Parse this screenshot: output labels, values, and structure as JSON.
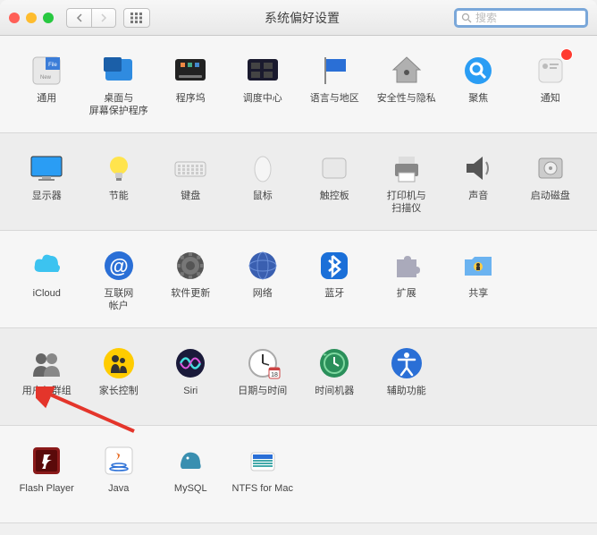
{
  "window": {
    "title": "系统偏好设置",
    "search_placeholder": "搜索"
  },
  "rows": [
    {
      "items": [
        {
          "id": "general",
          "label": "通用",
          "icon": "general"
        },
        {
          "id": "desktop",
          "label": "桌面与\n屏幕保护程序",
          "icon": "desktop"
        },
        {
          "id": "dock",
          "label": "程序坞",
          "icon": "dock"
        },
        {
          "id": "mission",
          "label": "调度中心",
          "icon": "mission"
        },
        {
          "id": "language",
          "label": "语言与地区",
          "icon": "flag"
        },
        {
          "id": "security",
          "label": "安全性与隐私",
          "icon": "house"
        },
        {
          "id": "spotlight",
          "label": "聚焦",
          "icon": "search"
        },
        {
          "id": "notifications",
          "label": "通知",
          "icon": "notif",
          "badge": true
        }
      ]
    },
    {
      "items": [
        {
          "id": "displays",
          "label": "显示器",
          "icon": "display"
        },
        {
          "id": "energy",
          "label": "节能",
          "icon": "bulb"
        },
        {
          "id": "keyboard",
          "label": "键盘",
          "icon": "keyboard"
        },
        {
          "id": "mouse",
          "label": "鼠标",
          "icon": "mouse"
        },
        {
          "id": "trackpad",
          "label": "触控板",
          "icon": "trackpad"
        },
        {
          "id": "printers",
          "label": "打印机与\n扫描仪",
          "icon": "printer"
        },
        {
          "id": "sound",
          "label": "声音",
          "icon": "speaker"
        },
        {
          "id": "startup",
          "label": "启动磁盘",
          "icon": "disk"
        }
      ]
    },
    {
      "items": [
        {
          "id": "icloud",
          "label": "iCloud",
          "icon": "cloud"
        },
        {
          "id": "internet",
          "label": "互联网\n帐户",
          "icon": "at"
        },
        {
          "id": "software",
          "label": "软件更新",
          "icon": "gear"
        },
        {
          "id": "network",
          "label": "网络",
          "icon": "globe"
        },
        {
          "id": "bluetooth",
          "label": "蓝牙",
          "icon": "bt"
        },
        {
          "id": "extensions",
          "label": "扩展",
          "icon": "puzzle"
        },
        {
          "id": "sharing",
          "label": "共享",
          "icon": "folder"
        }
      ]
    },
    {
      "items": [
        {
          "id": "users",
          "label": "用户与群组",
          "icon": "users"
        },
        {
          "id": "parental",
          "label": "家长控制",
          "icon": "parental"
        },
        {
          "id": "siri",
          "label": "Siri",
          "icon": "siri"
        },
        {
          "id": "datetime",
          "label": "日期与时间",
          "icon": "clock"
        },
        {
          "id": "timemachine",
          "label": "时间机器",
          "icon": "tm"
        },
        {
          "id": "accessibility",
          "label": "辅助功能",
          "icon": "access"
        }
      ]
    },
    {
      "items": [
        {
          "id": "flash",
          "label": "Flash Player",
          "icon": "flash"
        },
        {
          "id": "java",
          "label": "Java",
          "icon": "java"
        },
        {
          "id": "mysql",
          "label": "MySQL",
          "icon": "mysql"
        },
        {
          "id": "ntfs",
          "label": "NTFS for Mac",
          "icon": "ntfs"
        }
      ]
    }
  ],
  "arrow_target": "users"
}
